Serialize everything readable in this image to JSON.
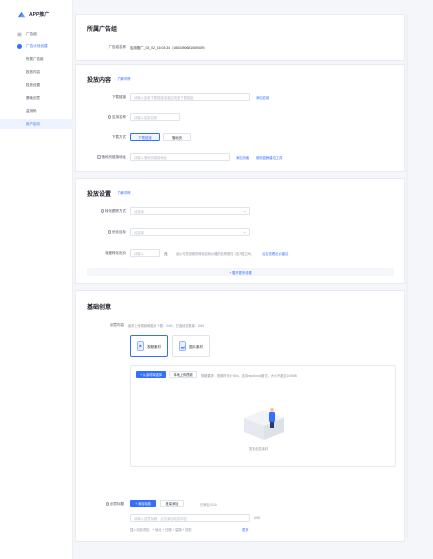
{
  "app": {
    "title": "APP推广"
  },
  "sidebar": {
    "items": [
      {
        "label": "广告组",
        "icon": "list-icon"
      },
      {
        "label": "广告计划创建",
        "icon": "plan-icon"
      }
    ],
    "subitems": [
      {
        "label": "所属广告组"
      },
      {
        "label": "投放内容"
      },
      {
        "label": "投放设置"
      },
      {
        "label": "基础创意"
      },
      {
        "label": "监测码"
      },
      {
        "label": "用户定向"
      }
    ]
  },
  "adgroup_card": {
    "title": "所属广告组",
    "field_label": "广告组名称",
    "field_value": "应用推广_03_02_16:03:34（1663490681069309）"
  },
  "content_card": {
    "title": "投放内容",
    "header_link": "了解详情",
    "download_link": {
      "label": "下载链接",
      "placeholder": "请输入应用下载链接或者应用宝下载链接",
      "action": "添加应用"
    },
    "app_name": {
      "label": "应用名称",
      "placeholder": "请输入应用名称"
    },
    "download_method": {
      "label": "下载方式",
      "options": [
        "下载链接",
        "落地页"
      ]
    },
    "landing_link": {
      "label": "落地页链接地址",
      "placeholder": "请输入落地页链接地址",
      "action1": "添加页面",
      "action2": "使用蓝鲸建站工具"
    }
  },
  "settings_card": {
    "title": "投放设置",
    "header_link": "了解详情",
    "bid_method": {
      "label": "转化跟踪方式",
      "placeholder": "请选择"
    },
    "opt_target": {
      "label": "优化目标",
      "placeholder": "请选择"
    },
    "deep_bid": {
      "label": "深度转化出价",
      "placeholder": "请输入",
      "unit": "元",
      "hint": "出价与您设置的转化目标价格的比例需在 1至2倍之间，",
      "hint_link": "点击查看出价建议"
    },
    "add_button": "+ 展开更多设置"
  },
  "creative_card": {
    "title": "基础创意",
    "creative_content": {
      "label": "创意内容",
      "hint": "最多上传视频和图片个数：0/40，已选创意数量：0/40"
    },
    "tiles": [
      {
        "label": "视频素材",
        "icon": "video-icon"
      },
      {
        "label": "图片素材",
        "icon": "image-icon"
      }
    ],
    "upload": {
      "btn_primary": "+ 从素材库选择",
      "btn_plain": "本地上传视频",
      "hint": "规格要求：视频时长5~60s，支持mp4/mov格式，大小不超过100MB"
    },
    "empty_text": "暂无创意素材",
    "title_field": {
      "label": "创意标题",
      "btn_primary": "+ 添加标题",
      "btn_plain": "批量添加",
      "count": "已添加 0/10"
    },
    "title_input": {
      "placeholder": "请输入创意标题，点击添加动态词包",
      "counter": "0/30"
    },
    "footer_text": "插入动态词包：+ 地点 + 日期 + 星期 + 性别",
    "footer_link": "更多"
  }
}
